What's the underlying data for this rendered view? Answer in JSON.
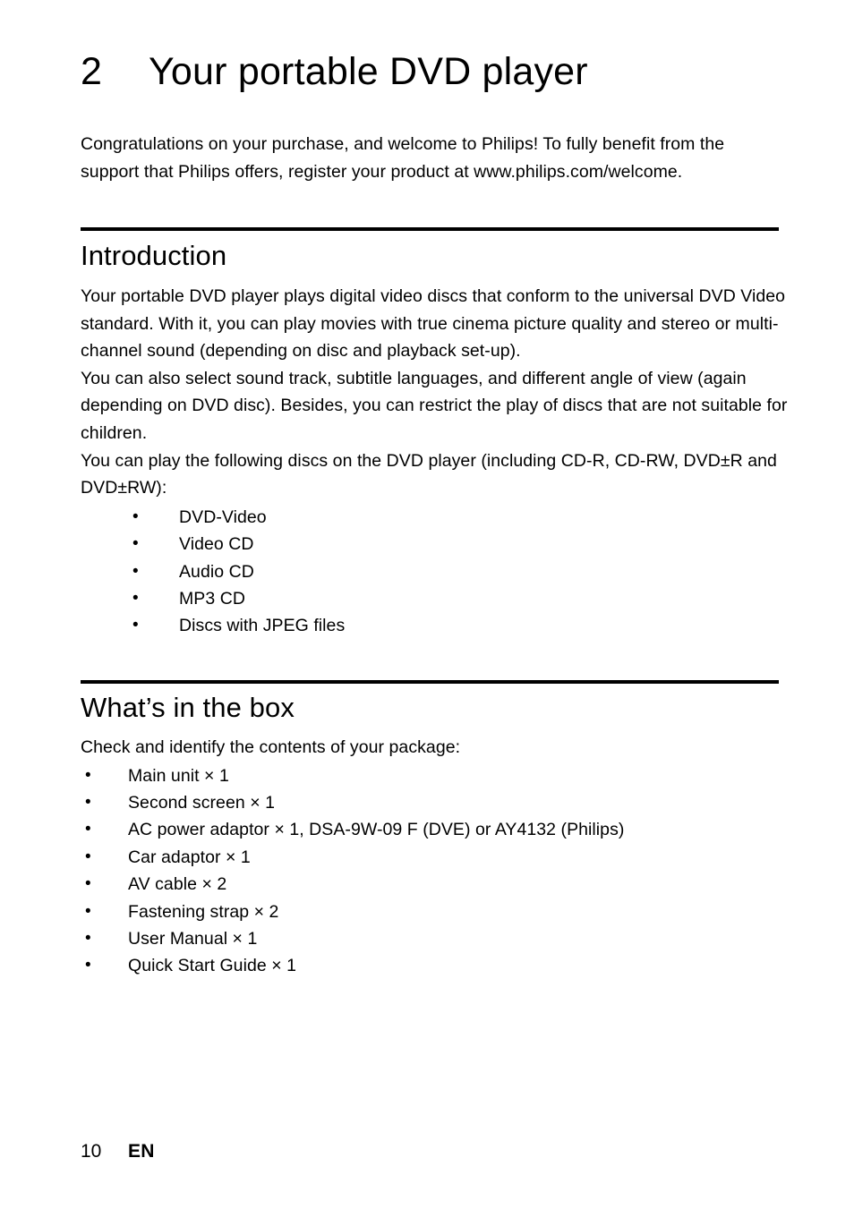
{
  "chapter": {
    "number": "2",
    "title": "Your portable DVD player"
  },
  "intro_paragraph": "Congratulations on your purchase, and welcome to Philips! To fully benefit from the support that Philips offers, register your product at www.philips.com/welcome.",
  "sections": [
    {
      "heading": "Introduction",
      "paragraphs": [
        "Your portable DVD player plays digital video discs that conform to the universal DVD Video standard. With it, you can play movies with true cinema picture quality and stereo or multi-channel sound (depending on disc and playback set-up).",
        "You can also select sound track, subtitle languages, and different angle of view (again depending on DVD disc). Besides, you can restrict the play of discs that are not suitable for children.",
        "You can play the following discs on the DVD player (including CD-R, CD-RW, DVD±R and DVD±RW):"
      ],
      "bullets": [
        "DVD-Video",
        "Video CD",
        "Audio CD",
        "MP3 CD",
        "Discs with JPEG files"
      ]
    },
    {
      "heading": "What’s in the box",
      "paragraphs": [
        "Check and identify the contents of your package:"
      ],
      "bullets": [
        "Main unit × 1",
        "Second screen × 1",
        "AC power adaptor × 1, DSA-9W-09 F (DVE) or AY4132 (Philips)",
        "Car adaptor × 1",
        "AV cable × 2",
        "Fastening strap × 2",
        "User Manual × 1",
        "Quick Start Guide × 1"
      ]
    }
  ],
  "footer": {
    "page_number": "10",
    "language": "EN"
  },
  "bullet_glyph": "•",
  "colors": {
    "text": "#000000",
    "background": "#ffffff",
    "rule": "#000000"
  }
}
